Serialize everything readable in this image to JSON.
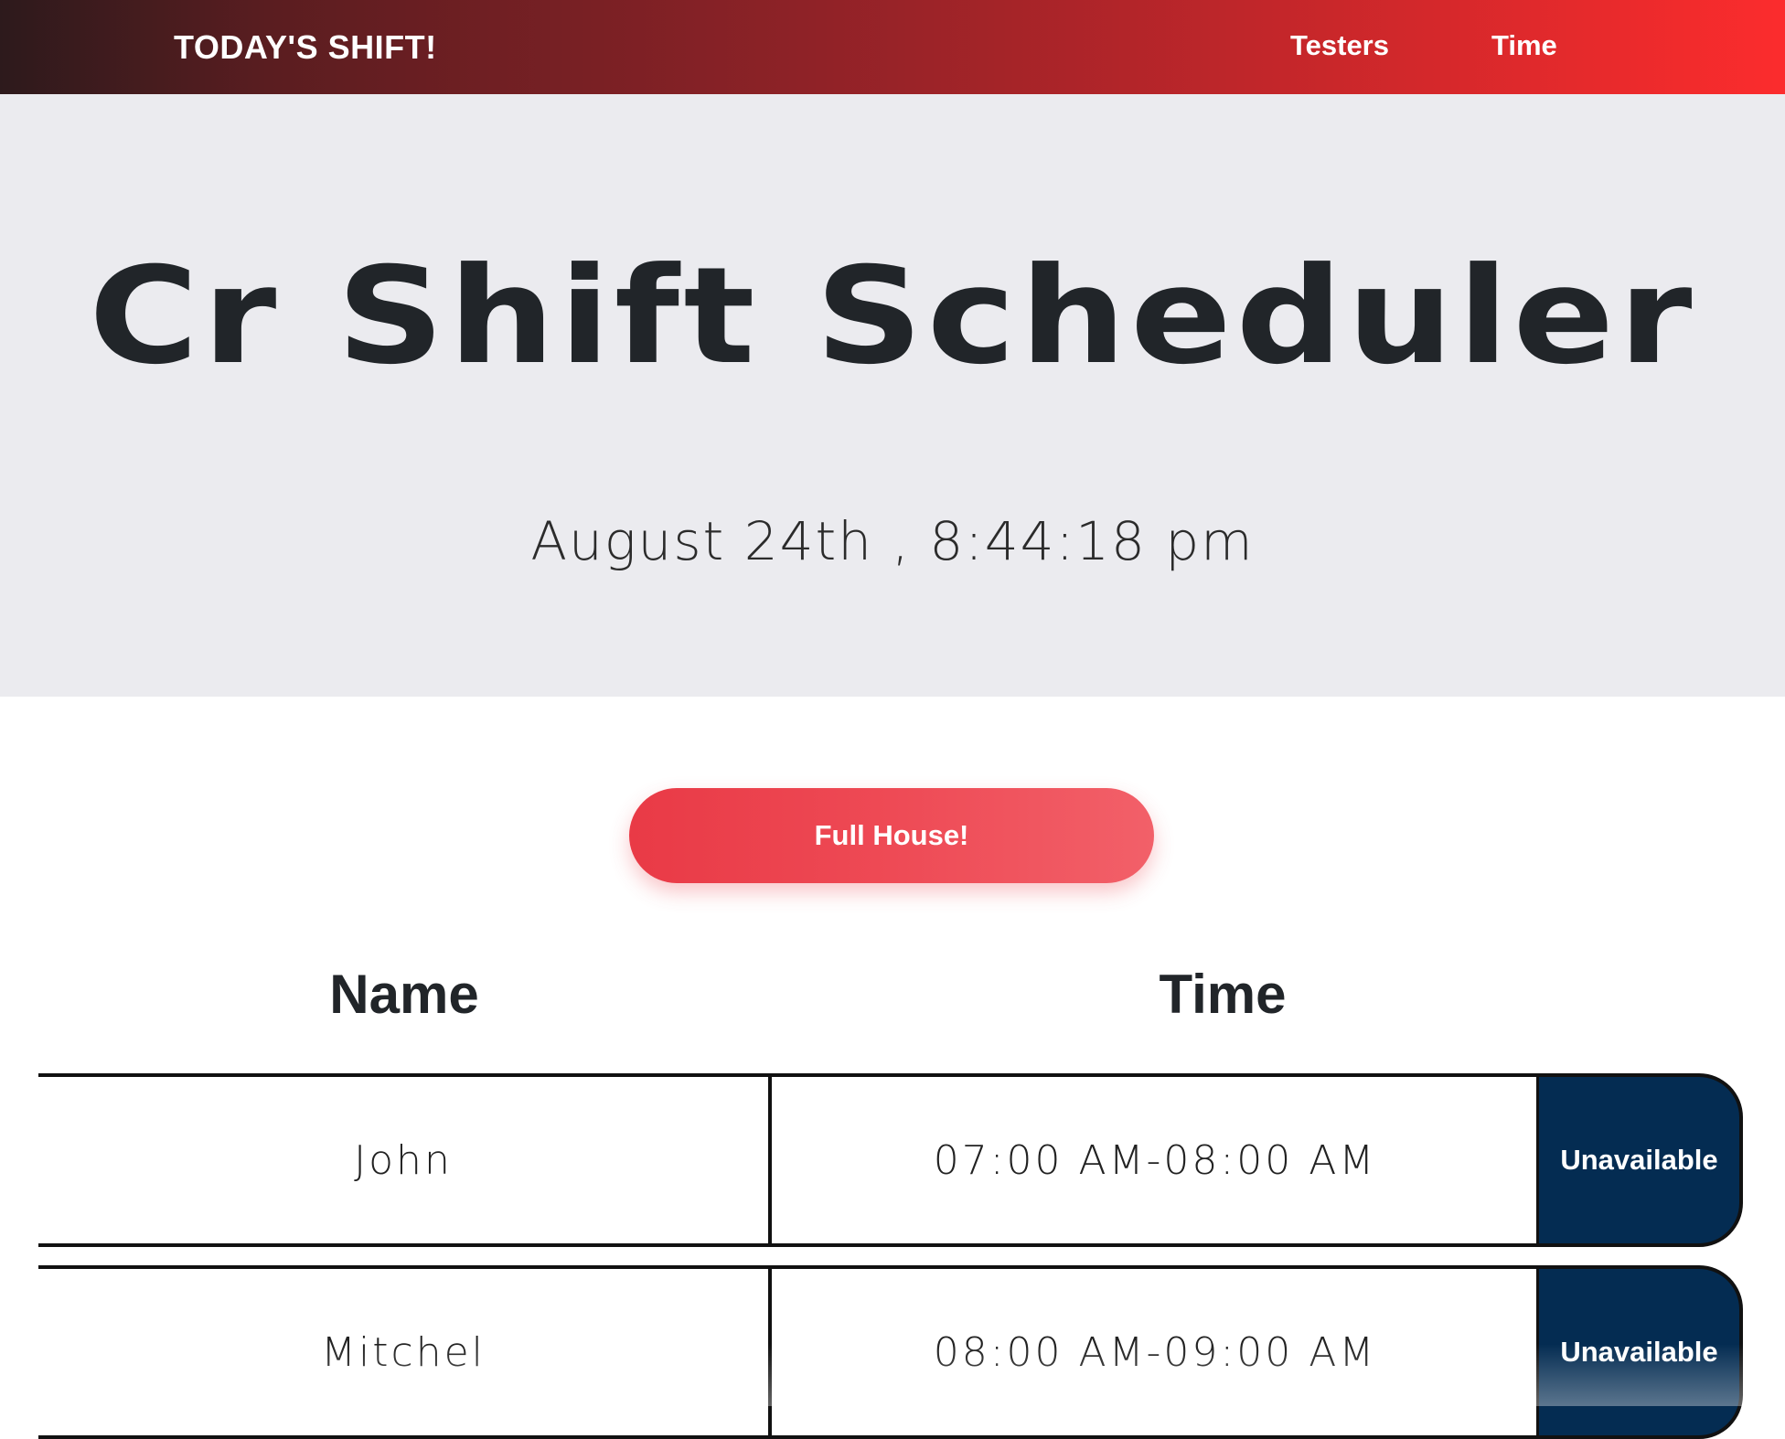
{
  "navbar": {
    "brand": "TODAY'S SHIFT!",
    "links": [
      {
        "label": "Testers"
      },
      {
        "label": "Time"
      }
    ]
  },
  "hero": {
    "title": "Cr Shift Scheduler",
    "datetime": "August 24th , 8:44:18 pm"
  },
  "status": {
    "label": "Full House!"
  },
  "table": {
    "headers": {
      "name": "Name",
      "time": "Time"
    },
    "rows": [
      {
        "name": "John",
        "time": "07:00 AM-08:00 AM",
        "action": "Unavailable"
      },
      {
        "name": "Mitchel",
        "time": "08:00 AM-09:00 AM",
        "action": "Unavailable"
      }
    ]
  },
  "colors": {
    "nav_gradient_start": "#2d1a1c",
    "nav_gradient_end": "#fc2c2d",
    "hero_bg": "#ebebef",
    "status_button": "#ee4a55",
    "unavailable_button": "#042c52"
  }
}
